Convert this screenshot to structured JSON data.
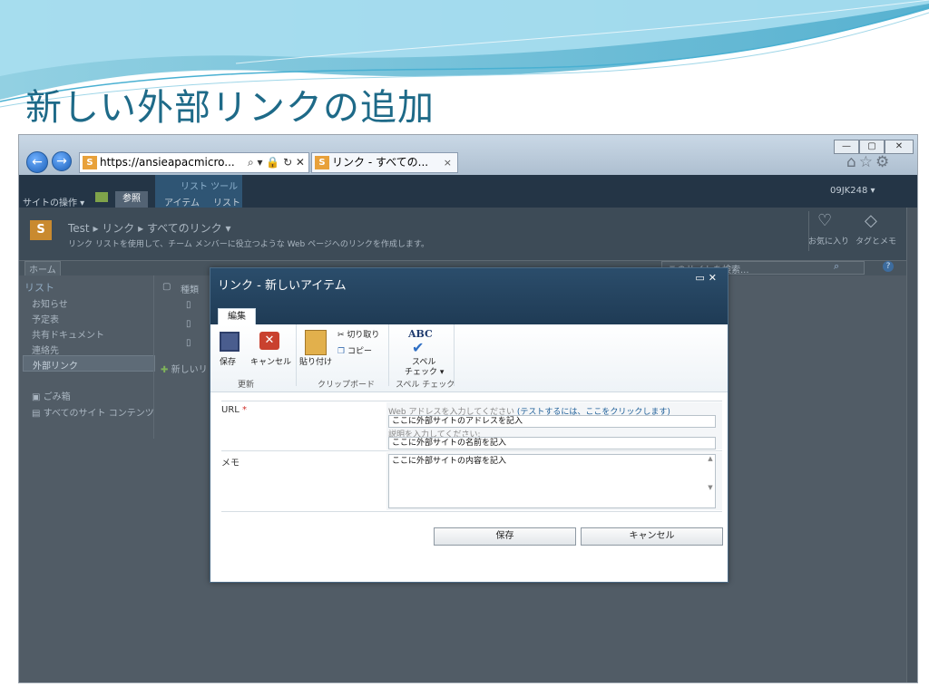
{
  "slide": {
    "title": "新しい外部リンクの追加"
  },
  "browser": {
    "address": "https://ansieapacmicro...",
    "tab_title": "リンク - すべての...",
    "sp_icon_text": "S"
  },
  "sharepoint": {
    "site_actions": "サイトの操作 ▾",
    "browse_tab": "参照",
    "ribbon_group_title": "リスト ツール",
    "tab_items": "アイテム",
    "tab_list": "リスト",
    "user": "09JK248 ▾",
    "breadcrumb_site": "Test",
    "breadcrumb_list": "リンク",
    "breadcrumb_view": "すべてのリンク",
    "page_description": "リンク リストを使用して、チーム メンバーに役立つような Web ページへのリンクを作成します。",
    "like_label": "お気に入り",
    "tags_label": "タグとメモ",
    "home_tab": "ホーム",
    "search_placeholder": "このサイトを検索...",
    "quick_launch": {
      "heading": "リスト",
      "items": [
        "お知らせ",
        "予定表",
        "共有ドキュメント",
        "連絡先",
        "外部リンク"
      ],
      "recycle_bin": "ごみ箱",
      "all_content": "すべてのサイト コンテンツ"
    },
    "list_type_header": "種類",
    "new_link": "新しいリ"
  },
  "dialog": {
    "title": "リンク - 新しいアイテム",
    "tab_edit": "編集",
    "ribbon": {
      "save": "保存",
      "cancel": "キャンセル",
      "paste": "貼り付け",
      "cut": "切り取り",
      "copy": "コピー",
      "spelling_line1": "スペル",
      "spelling_line2": "チェック ▾",
      "abc": "ABC",
      "group_commit": "更新",
      "group_clipboard": "クリップボード",
      "group_spelling": "スペル チェック"
    },
    "fields": {
      "url_label": "URL",
      "required_mark": "*",
      "url_hint": "Web アドレスを入力してください",
      "url_test_link": "(テストするには、ここをクリックします)",
      "url_value": "ここに外部サイトのアドレスを記入",
      "desc_hint": "説明を入力してください:",
      "desc_value": "ここに外部サイトの名前を記入",
      "memo_label": "メモ",
      "memo_value": "ここに外部サイトの内容を記入"
    },
    "buttons": {
      "save": "保存",
      "cancel": "キャンセル"
    }
  }
}
